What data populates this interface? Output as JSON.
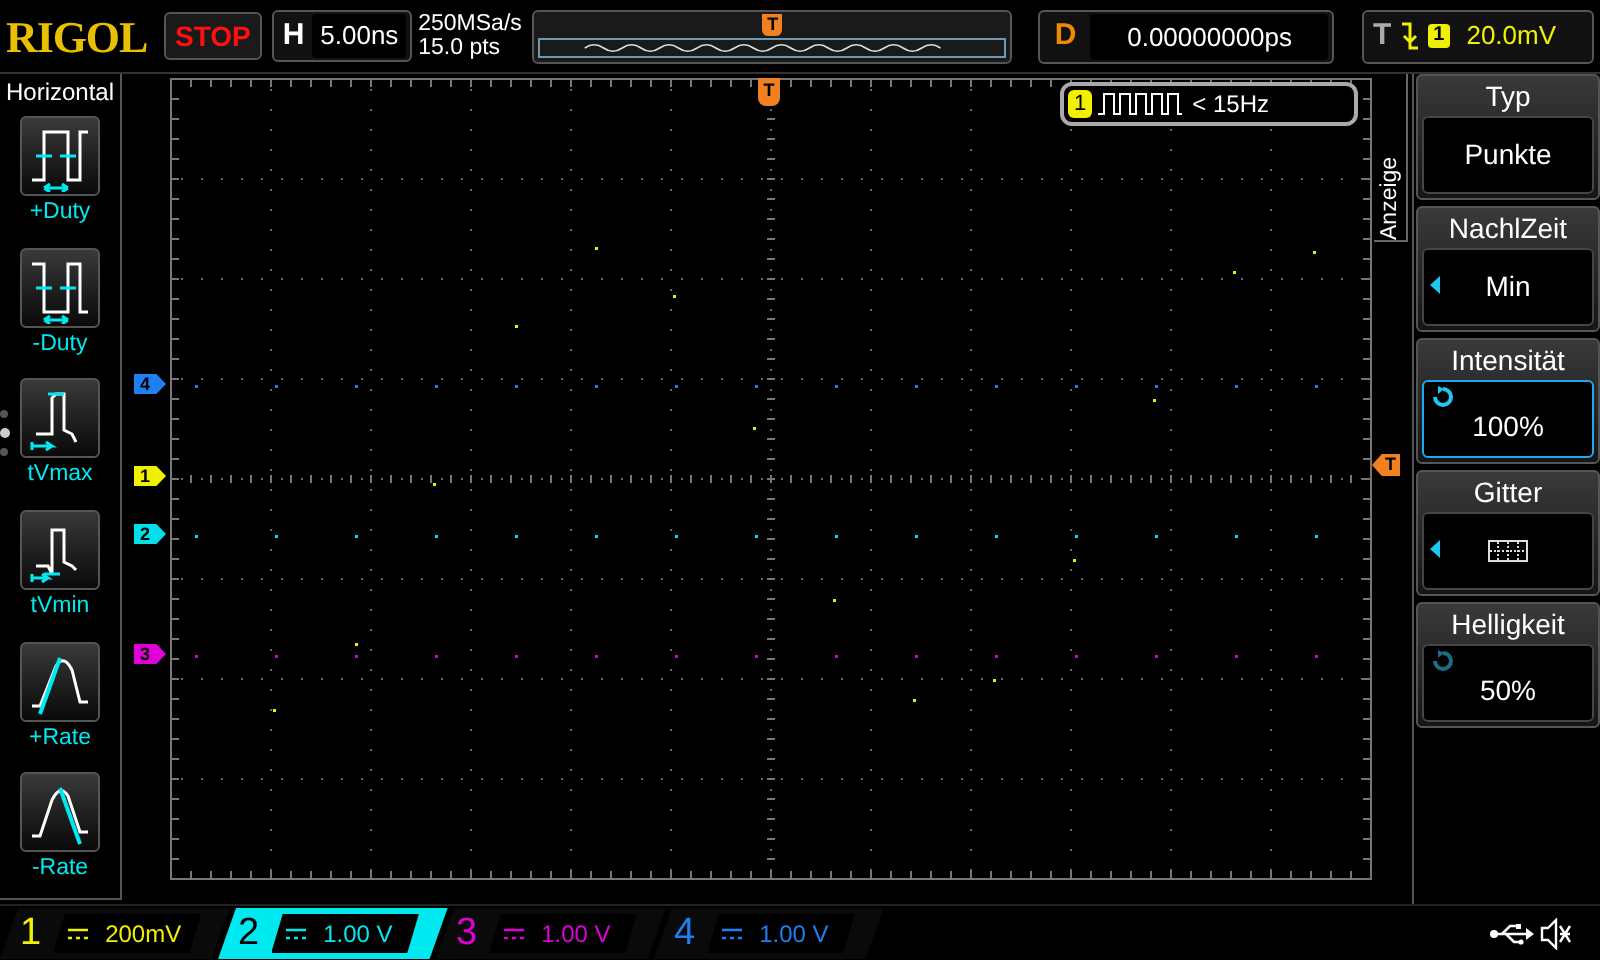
{
  "top_bar": {
    "logo": "RIGOL",
    "run_status": "STOP",
    "timebase": {
      "label": "H",
      "value": "5.00ns"
    },
    "sample_rate": "250MSa/s",
    "memory_depth": "15.0 pts",
    "trigger_position_marker": "T",
    "delay": {
      "label": "D",
      "value": "0.00000000ps"
    },
    "trigger": {
      "label": "T",
      "source": "1",
      "level": "20.0mV"
    }
  },
  "left_menu": {
    "title": "Horizontal",
    "items": [
      {
        "kind": "pos-duty",
        "label": "+Duty"
      },
      {
        "kind": "neg-duty",
        "label": "-Duty"
      },
      {
        "kind": "tvmax",
        "label": "tVmax"
      },
      {
        "kind": "tvmin",
        "label": "tVmin"
      },
      {
        "kind": "pos-rate",
        "label": "+Rate"
      },
      {
        "kind": "neg-rate",
        "label": "-Rate"
      }
    ],
    "pages": [
      {
        "selected": false
      },
      {
        "selected": true
      },
      {
        "selected": false
      }
    ]
  },
  "screen": {
    "trigger_marker_top": "T",
    "trigger_marker_right": "T",
    "frequency_counter": {
      "source": "1",
      "reading": "< 15Hz"
    },
    "channel_markers": [
      {
        "label": "4",
        "color": "#1e7ff0"
      },
      {
        "label": "1",
        "color": "#f0f000"
      },
      {
        "label": "2",
        "color": "#00e0e8"
      },
      {
        "label": "3",
        "color": "#e000d8"
      }
    ]
  },
  "right_menu": {
    "title": "Anzeige",
    "items": [
      {
        "kind": "value",
        "label": "Typ",
        "value": "Punkte",
        "selected": false
      },
      {
        "kind": "choice",
        "label": "NachlZeit",
        "value": "Min",
        "selected": false
      },
      {
        "kind": "knob",
        "label": "Intensität",
        "value": "100%",
        "selected": true
      },
      {
        "kind": "grid-icon",
        "label": "Gitter",
        "selected": false
      },
      {
        "kind": "knob",
        "label": "Helligkeit",
        "value": "50%",
        "selected": false
      }
    ]
  },
  "channels": [
    {
      "label": "1",
      "scale": "200mV",
      "color": "#f0f000",
      "selected": false
    },
    {
      "label": "2",
      "scale": "1.00 V",
      "color": "#00e8f0",
      "selected": true
    },
    {
      "label": "3",
      "scale": "1.00 V",
      "color": "#e000d8",
      "selected": false
    },
    {
      "label": "4",
      "scale": "1.00 V",
      "color": "#1e7ff0",
      "selected": false
    }
  ]
}
